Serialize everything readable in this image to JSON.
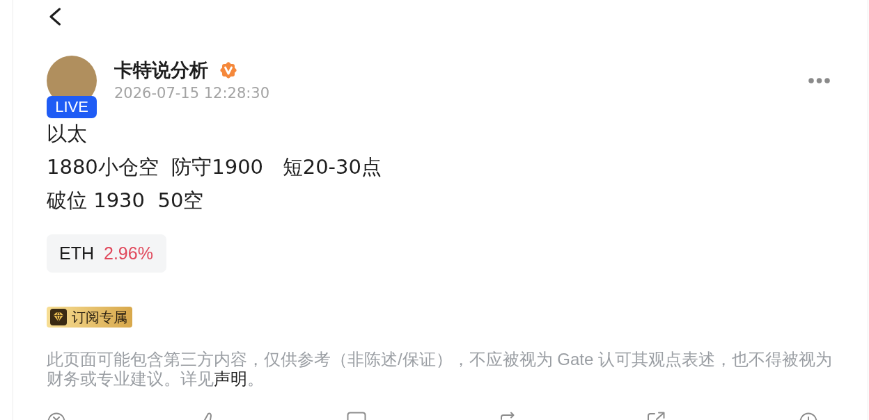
{
  "author": {
    "name": "卡特说分析",
    "verified": true,
    "live_label": "LIVE",
    "timestamp": "2026-07-15 12:28:30"
  },
  "post": {
    "lines": [
      "以太",
      "1880小仓空  防守1900   短20-30点",
      "破位 1930  50空"
    ]
  },
  "ticker": {
    "symbol": "ETH",
    "change": "2.96%",
    "rising": true
  },
  "badge": {
    "label": "订阅专属"
  },
  "disclaimer": {
    "text": "此页面可能包含第三方内容，仅供参考（非陈述/保证），不应被视为 Gate 认可其观点表述，也不得被视为财务或专业建议。详见",
    "link": "声明",
    "end": "。"
  }
}
